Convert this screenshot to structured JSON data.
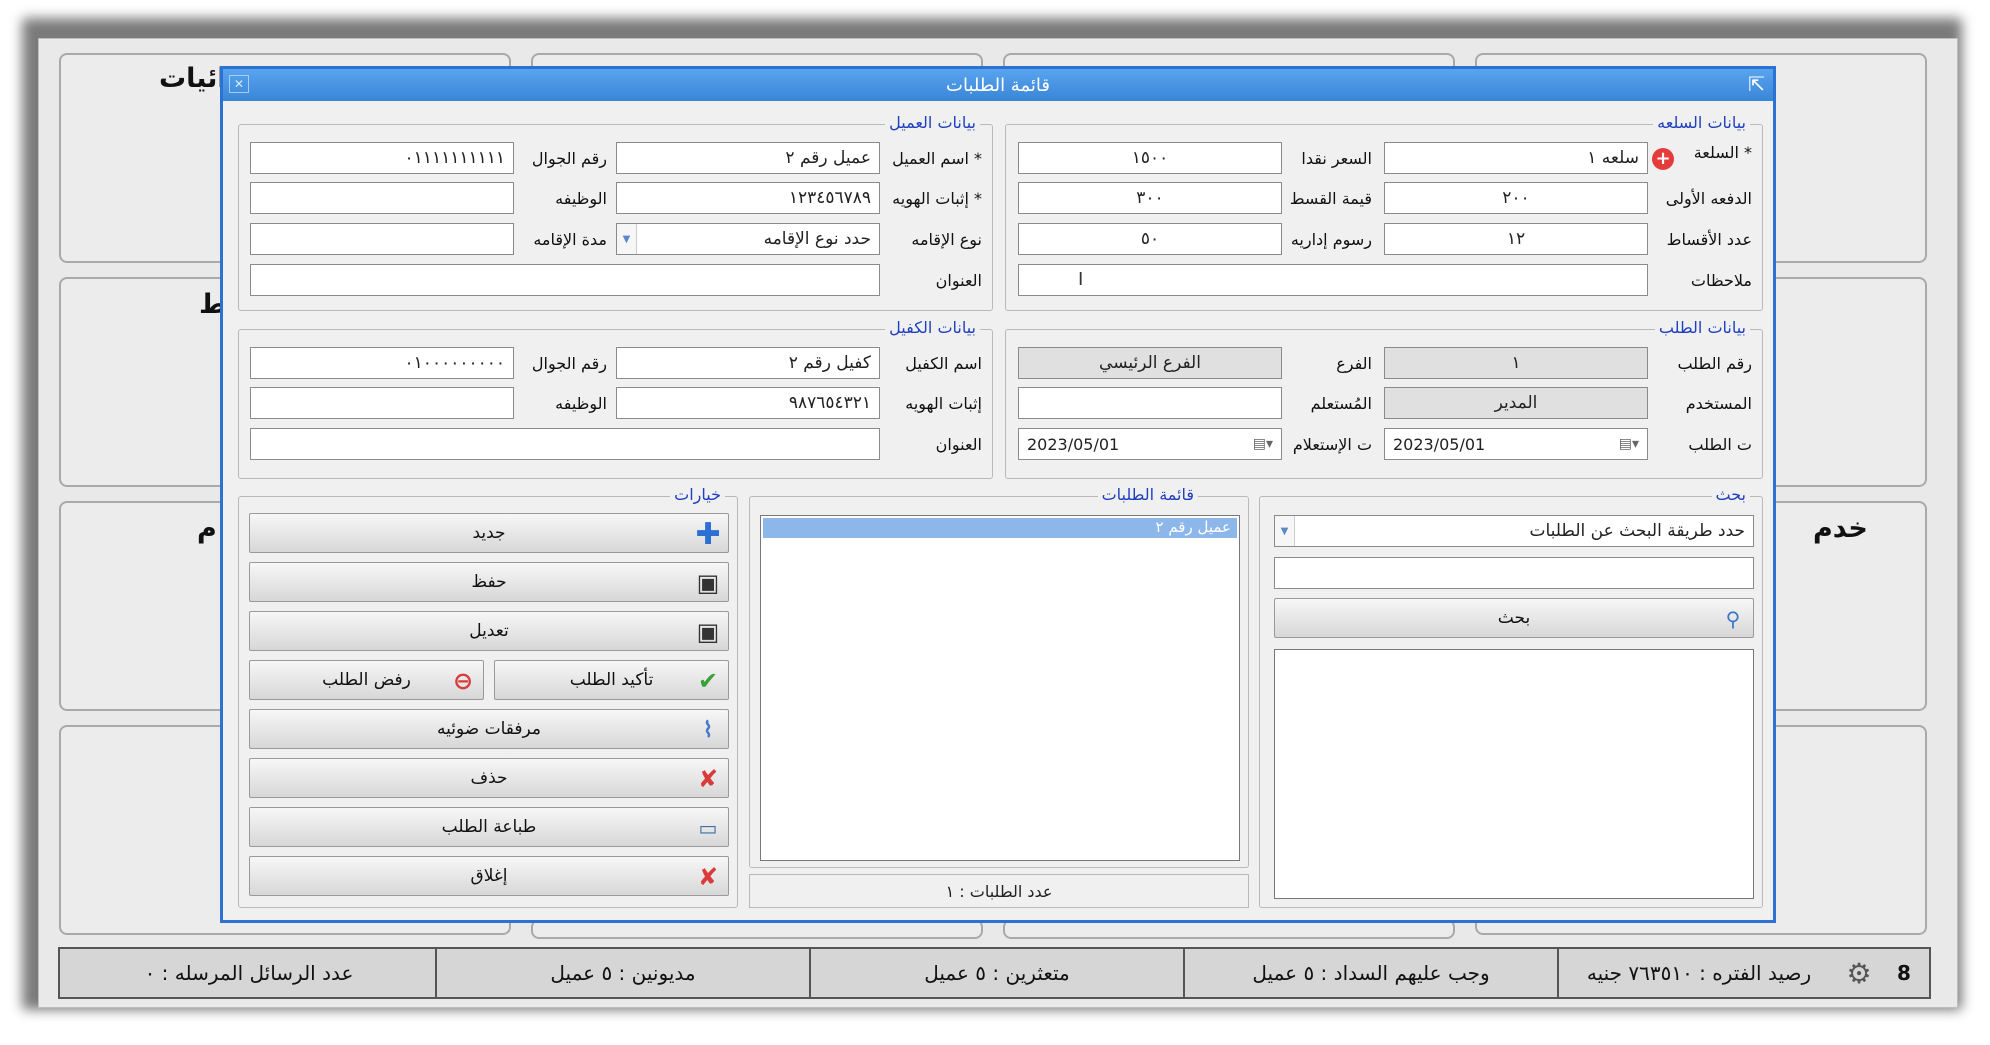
{
  "background": {
    "texts": {
      "t1": "ائيات",
      "t2": "ط",
      "t3": "م",
      "t4": "خدم"
    },
    "status_bar": {
      "number": "8",
      "gear_icon": "gear-icon",
      "balance": "رصيد الفتره : ٧٦٣٥١٠ جنيه",
      "due": "وجب عليهم السداد : ٥ عميل",
      "late": "متعثرين : ٥ عميل",
      "debtors": "مديونين : ٥ عميل",
      "messages": "عدد الرسائل المرسله : ٠"
    }
  },
  "dialog": {
    "title": "قائمة الطلبات",
    "close_symbol": "✕",
    "pin_symbol": "⇱",
    "product": {
      "title": "بيانات السلعه",
      "item_label": "* السلعة",
      "item_value": "سلعه ١",
      "cash_price_label": "السعر نقدا",
      "cash_price_value": "١٥٠٠",
      "down_payment_label": "الدفعه الأولى",
      "down_payment_value": "٢٠٠",
      "installment_value_label": "قيمة القسط",
      "installment_value_value": "٣٠٠",
      "installments_count_label": "عدد الأقساط",
      "installments_count_value": "١٢",
      "admin_fees_label": "رسوم إداريه",
      "admin_fees_value": "٥٠",
      "notes_label": "ملاحظات",
      "notes_value": ""
    },
    "customer": {
      "title": "بيانات العميل",
      "name_label": "* اسم العميل",
      "name_value": "عميل رقم ٢",
      "mobile_label": "رقم الجوال",
      "mobile_value": "٠١١١١١١١١١١",
      "id_label": "* إثبات الهويه",
      "id_value": "١٢٣٤٥٦٧٨٩",
      "job_label": "الوظيفه",
      "job_value": "",
      "residence_type_label": "نوع الإقامه",
      "residence_type_value": "حدد نوع الإقامه",
      "residence_duration_label": "مدة الإقامه",
      "residence_duration_value": "",
      "address_label": "العنوان",
      "address_value": ""
    },
    "request": {
      "title": "بيانات الطلب",
      "number_label": "رقم الطلب",
      "number_value": "١",
      "branch_label": "الفرع",
      "branch_value": "الفرع الرئيسي",
      "user_label": "المستخدم",
      "user_value": "المدير",
      "inquirer_label": "المُستعلم",
      "inquirer_value": "",
      "date_label": "ت الطلب",
      "date_value": "2023/05/01",
      "inquiry_date_label": "ت الإستعلام",
      "inquiry_date_value": "2023/05/01"
    },
    "guarantor": {
      "title": "بيانات الكفيل",
      "name_label": "اسم الكفيل",
      "name_value": "كفيل رقم ٢",
      "mobile_label": "رقم الجوال",
      "mobile_value": "٠١٠٠٠٠٠٠٠٠٠",
      "id_label": "إثبات الهويه",
      "id_value": "٩٨٧٦٥٤٣٢١",
      "job_label": "الوظيفه",
      "job_value": "",
      "address_label": "العنوان",
      "address_value": ""
    },
    "search": {
      "title": "بحث",
      "method_value": "حدد طريقة البحث عن الطلبات",
      "query_value": "",
      "button": "بحث"
    },
    "requests_list": {
      "title": "قائمة الطلبات",
      "items": [
        "عميل رقم ٢"
      ],
      "count": "عدد الطلبات : ١"
    },
    "options": {
      "title": "خيارات",
      "new": "جديد",
      "save": "حفظ",
      "edit": "تعديل",
      "confirm": "تأكيد الطلب",
      "reject": "رفض الطلب",
      "attachments": "مرفقات ضوئيه",
      "delete": "حذف",
      "print": "طباعة الطلب",
      "close": "إغلاق"
    }
  },
  "colors": {
    "title_bar": "#3a86d8",
    "group_title": "#1f3fbf",
    "selection": "#8db6ea"
  }
}
